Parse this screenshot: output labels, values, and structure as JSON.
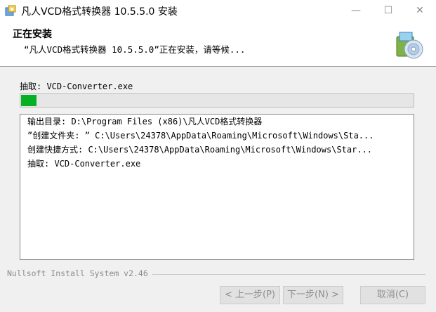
{
  "window": {
    "title": "凡人VCD格式转换器 10.5.5.0 安装",
    "min_glyph": "—",
    "max_glyph": "☐",
    "close_glyph": "✕"
  },
  "header": {
    "title": "正在安装",
    "subtitle": "“凡人VCD格式转换器 10.5.5.0”正在安装，请等候..."
  },
  "status": {
    "label": "抽取: VCD-Converter.exe",
    "progress_percent": 4
  },
  "log": {
    "lines": [
      "输出目录: D:\\Program Files (x86)\\凡人VCD格式转换器",
      "”创建文件夹: ” C:\\Users\\24378\\AppData\\Roaming\\Microsoft\\Windows\\Sta...",
      "创建快捷方式: C:\\Users\\24378\\AppData\\Roaming\\Microsoft\\Windows\\Star...",
      "抽取: VCD-Converter.exe"
    ]
  },
  "footer": {
    "brand": "Nullsoft Install System v2.46",
    "prev_label": "< 上一步(P)",
    "next_label": "下一步(N) >",
    "cancel_label": "取消(C)"
  },
  "colors": {
    "progress_fill": "#06b025",
    "disabled_text": "#8d8d8d"
  },
  "icons": [
    "installer-app-icon",
    "setup-cd-icon"
  ]
}
